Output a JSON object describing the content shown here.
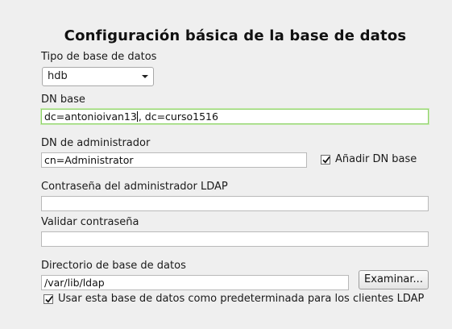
{
  "title": "Configuración básica de la base de datos",
  "db_type": {
    "label": "Tipo de base de datos",
    "value": "hdb"
  },
  "base_dn": {
    "label": "DN base",
    "value_before_cursor": "dc=antonioivan13",
    "value_after_cursor": ", dc=curso1516"
  },
  "admin_dn": {
    "label": "DN de administrador",
    "value": "cn=Administrator",
    "append_checkbox_label": "Añadir DN base",
    "append_checked": true
  },
  "admin_password": {
    "label": "Contraseña del administrador LDAP",
    "value": ""
  },
  "confirm_password": {
    "label": "Validar contraseña",
    "value": ""
  },
  "db_directory": {
    "label": "Directorio de base de datos",
    "value": "/var/lib/ldap",
    "browse_button": "Examinar..."
  },
  "default_db": {
    "label": "Usar esta base de datos como predeterminada para los clientes LDAP",
    "checked": true
  }
}
